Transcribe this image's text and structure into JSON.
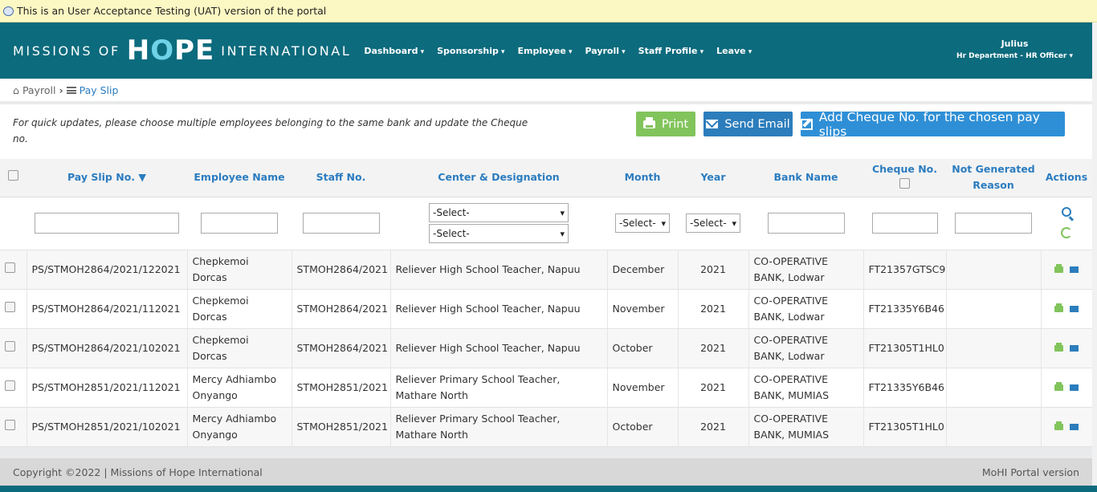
{
  "uat_banner": "This is an User Acceptance Testing (UAT) version of the portal",
  "brand": {
    "part1": "MISSIONS OF",
    "part2a": "H",
    "part2b": "O",
    "part2c": "PE",
    "part3": "INTERNATIONAL"
  },
  "nav": [
    "Dashboard",
    "Sponsorship",
    "Employee",
    "Payroll",
    "Staff Profile",
    "Leave"
  ],
  "user": {
    "name": "Julius",
    "role": "Hr Department - HR Officer"
  },
  "breadcrumb": {
    "home": "Payroll",
    "current": "Pay Slip"
  },
  "toolbar": {
    "note": "For quick updates, please choose multiple employees belonging to the same bank and update the Cheque no.",
    "print": "Print",
    "send_email": "Send Email",
    "add_cheque": "Add Cheque No. for the chosen pay slips"
  },
  "columns": {
    "payslip": "Pay Slip No. ▼",
    "employee": "Employee Name",
    "staff": "Staff No.",
    "center": "Center & Designation",
    "month": "Month",
    "year": "Year",
    "bank": "Bank Name",
    "cheque": "Cheque No.",
    "not_generated": "Not Generated Reason",
    "actions": "Actions"
  },
  "filters": {
    "select": "-Select-"
  },
  "rows": [
    {
      "payslip": "PS/STMOH2864/2021/122021",
      "employee": "Chepkemoi Dorcas",
      "staff": "STMOH2864/2021",
      "center": "Reliever High School Teacher, Napuu",
      "month": "December",
      "year": "2021",
      "bank": "CO-OPERATIVE BANK, Lodwar",
      "cheque": "FT21357GTSC9"
    },
    {
      "payslip": "PS/STMOH2864/2021/112021",
      "employee": "Chepkemoi Dorcas",
      "staff": "STMOH2864/2021",
      "center": "Reliever High School Teacher, Napuu",
      "month": "November",
      "year": "2021",
      "bank": "CO-OPERATIVE BANK, Lodwar",
      "cheque": "FT21335Y6B46"
    },
    {
      "payslip": "PS/STMOH2864/2021/102021",
      "employee": "Chepkemoi Dorcas",
      "staff": "STMOH2864/2021",
      "center": "Reliever High School Teacher, Napuu",
      "month": "October",
      "year": "2021",
      "bank": "CO-OPERATIVE BANK, Lodwar",
      "cheque": "FT21305T1HL0"
    },
    {
      "payslip": "PS/STMOH2851/2021/112021",
      "employee": "Mercy Adhiambo Onyango",
      "staff": "STMOH2851/2021",
      "center": "Reliever Primary School Teacher, Mathare North",
      "month": "November",
      "year": "2021",
      "bank": "CO-OPERATIVE BANK, MUMIAS",
      "cheque": "FT21335Y6B46"
    },
    {
      "payslip": "PS/STMOH2851/2021/102021",
      "employee": "Mercy Adhiambo Onyango",
      "staff": "STMOH2851/2021",
      "center": "Reliever Primary School Teacher, Mathare North",
      "month": "October",
      "year": "2021",
      "bank": "CO-OPERATIVE BANK, MUMIAS",
      "cheque": "FT21305T1HL0"
    }
  ],
  "footer": {
    "copyright": "Copyright ©2022 | Missions of Hope International",
    "version": "MoHI Portal version"
  },
  "colors": {
    "nav_bg": "#0c6b7d",
    "accent_blue": "#2b7cc0",
    "print_green": "#82c45c",
    "uat_yellow": "#fcf8c3"
  },
  "icons": [
    "home-icon",
    "list-icon",
    "printer-icon",
    "envelope-icon",
    "edit-icon",
    "search-icon",
    "refresh-icon"
  ]
}
